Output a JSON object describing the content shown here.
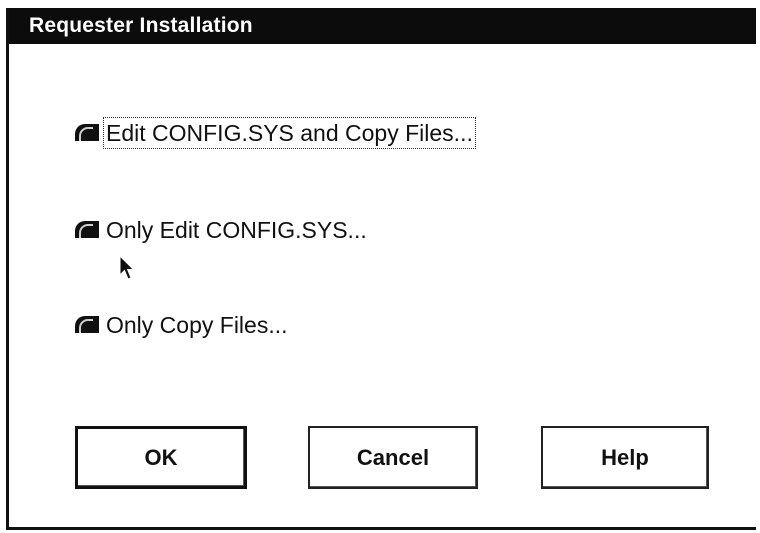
{
  "window": {
    "title": "Requester Installation"
  },
  "options": [
    {
      "label": "Edit CONFIG.SYS and Copy Files...",
      "icon": "push-button-icon",
      "focused": true
    },
    {
      "label": "Only Edit CONFIG.SYS...",
      "icon": "push-button-icon",
      "focused": false
    },
    {
      "label": "Only Copy Files...",
      "icon": "push-button-icon",
      "focused": false
    }
  ],
  "buttons": {
    "ok_label": "OK",
    "cancel_label": "Cancel",
    "help_label": "Help"
  },
  "colors": {
    "title_bar": "#0c0c0c",
    "title_text": "#ffffff",
    "background": "#ffffff"
  },
  "pointer_icon": "mouse-pointer-icon"
}
